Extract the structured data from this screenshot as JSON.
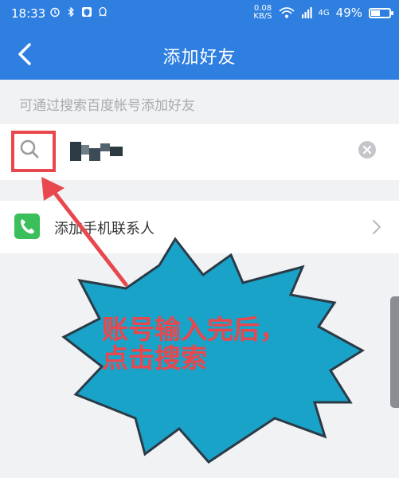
{
  "status_bar": {
    "time": "18:33",
    "speed_value": "0.08",
    "speed_unit": "KB/S",
    "signal_label": "4G",
    "battery_percent": "49%",
    "battery_level": 0.49
  },
  "nav": {
    "title": "添加好友",
    "back_icon": "chevron-left-icon"
  },
  "search": {
    "hint": "可通过搜索百度帐号添加好友",
    "input_value": "",
    "search_icon": "search-icon",
    "clear_icon": "clear-icon"
  },
  "contacts": {
    "label": "添加手机联系人",
    "icon": "phone-icon",
    "chevron_icon": "chevron-right-icon"
  },
  "annotation": {
    "callout_line1": "账号输入完后，",
    "callout_line2": "点击搜索"
  },
  "colors": {
    "header": "#2e7fe0",
    "highlight": "#e8474d",
    "burst": "#1aa3c9",
    "contacts_icon": "#3bbf5a"
  }
}
